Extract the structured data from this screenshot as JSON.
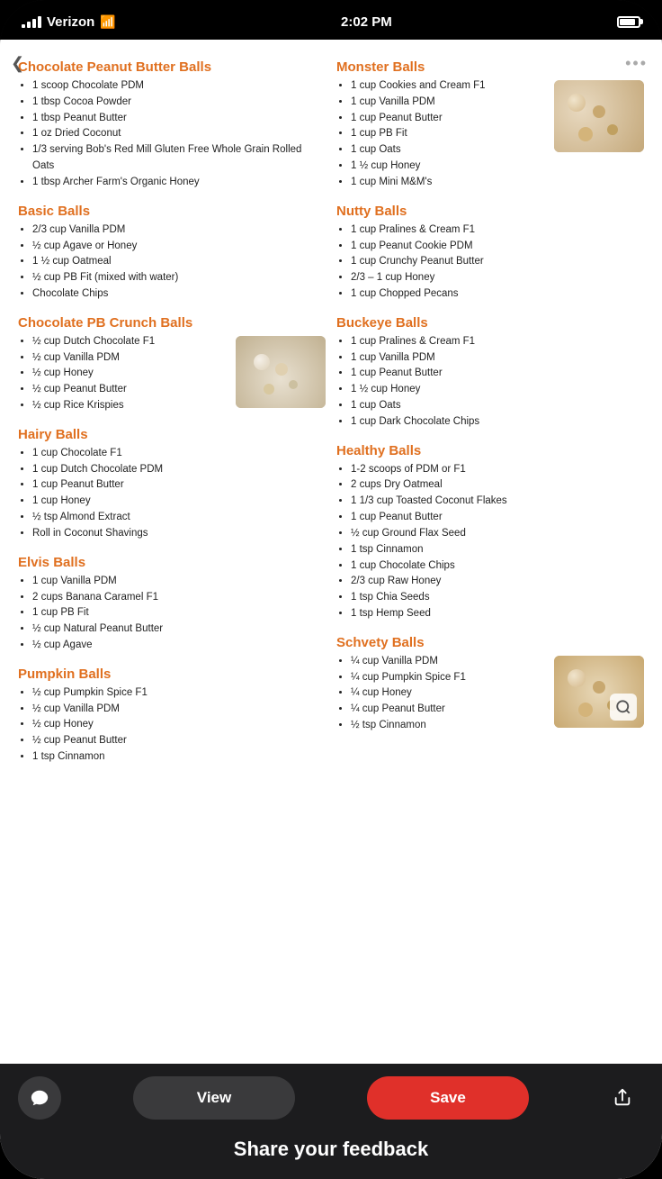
{
  "statusBar": {
    "carrier": "Verizon",
    "time": "2:02 PM"
  },
  "recipes": {
    "left": [
      {
        "id": "chocolate-pb-balls",
        "title": "Chocolate Peanut Butter Balls",
        "ingredients": [
          "1 scoop Chocolate PDM",
          "1 tbsp Cocoa Powder",
          "1 tbsp Peanut Butter",
          "1 oz Dried Coconut",
          "1/3 serving Bob's Red Mill Gluten Free Whole Grain Rolled Oats",
          "1 tbsp Archer Farm's Organic Honey"
        ]
      },
      {
        "id": "basic-balls",
        "title": "Basic Balls",
        "ingredients": [
          "2/3 cup Vanilla PDM",
          "½ cup Agave or Honey",
          "1 ½ cup Oatmeal",
          "½ cup PB Fit (mixed with water)",
          "Chocolate Chips"
        ]
      },
      {
        "id": "chocolate-pb-crunch",
        "title": "Chocolate PB Crunch Balls",
        "ingredients": [
          "½ cup Dutch Chocolate F1",
          "½ cup Vanilla PDM",
          "½ cup Honey",
          "½ cup Peanut Butter",
          "½ cup Rice Krispies"
        ],
        "hasImage": true
      },
      {
        "id": "hairy-balls",
        "title": "Hairy Balls",
        "ingredients": [
          "1 cup Chocolate F1",
          "1 cup Dutch Chocolate PDM",
          "1 cup Peanut Butter",
          "1 cup Honey",
          "½ tsp Almond Extract",
          "Roll in Coconut Shavings"
        ]
      },
      {
        "id": "elvis-balls",
        "title": "Elvis Balls",
        "ingredients": [
          "1 cup Vanilla PDM",
          "2 cups Banana Caramel F1",
          "1 cup PB Fit",
          "½ cup Natural Peanut Butter",
          "½ cup Agave"
        ]
      },
      {
        "id": "pumpkin-balls",
        "title": "Pumpkin Balls",
        "ingredients": [
          "½ cup Pumpkin Spice F1",
          "½ cup Vanilla PDM",
          "½ cup Honey",
          "½ cup Peanut Butter",
          "1 tsp Cinnamon"
        ]
      }
    ],
    "right": [
      {
        "id": "monster-balls",
        "title": "Monster Balls",
        "ingredients": [
          "1 cup Cookies and Cream F1",
          "1 cup Vanilla PDM",
          "1 cup Peanut Butter",
          "1 cup PB Fit",
          "1 cup Oats",
          "1 ½ cup Honey",
          "1 cup Mini M&M's"
        ],
        "hasImage": true
      },
      {
        "id": "nutty-balls",
        "title": "Nutty Balls",
        "ingredients": [
          "1 cup Pralines & Cream F1",
          "1 cup Peanut Cookie PDM",
          "1 cup Crunchy Peanut Butter",
          "2/3 – 1 cup Honey",
          "1 cup Chopped Pecans"
        ]
      },
      {
        "id": "buckeye-balls",
        "title": "Buckeye Balls",
        "ingredients": [
          "1 cup Pralines & Cream F1",
          "1 cup Vanilla PDM",
          "1 cup Peanut Butter",
          "1 ½ cup Honey",
          "1 cup Oats",
          "1 cup Dark Chocolate Chips"
        ]
      },
      {
        "id": "healthy-balls",
        "title": "Healthy Balls",
        "ingredients": [
          "1-2 scoops of PDM or F1",
          "2 cups Dry Oatmeal",
          "1 1/3 cup Toasted Coconut Flakes",
          "1 cup Peanut Butter",
          "½ cup Ground Flax Seed",
          "1 tsp Cinnamon",
          "1 cup Chocolate Chips",
          "2/3 cup Raw Honey",
          "1 tsp Chia Seeds",
          "1 tsp Hemp Seed"
        ]
      },
      {
        "id": "schvety-balls",
        "title": "Schvety Balls",
        "ingredients": [
          "¼ cup Vanilla PDM",
          "¼ cup Pumpkin Spice F1",
          "¼ cup Honey",
          "¼ cup Peanut Butter",
          "½ tsp Cinnamon"
        ],
        "hasImage": true
      }
    ]
  },
  "bottomBar": {
    "viewLabel": "View",
    "saveLabel": "Save",
    "feedbackLabel": "Share your feedback"
  }
}
